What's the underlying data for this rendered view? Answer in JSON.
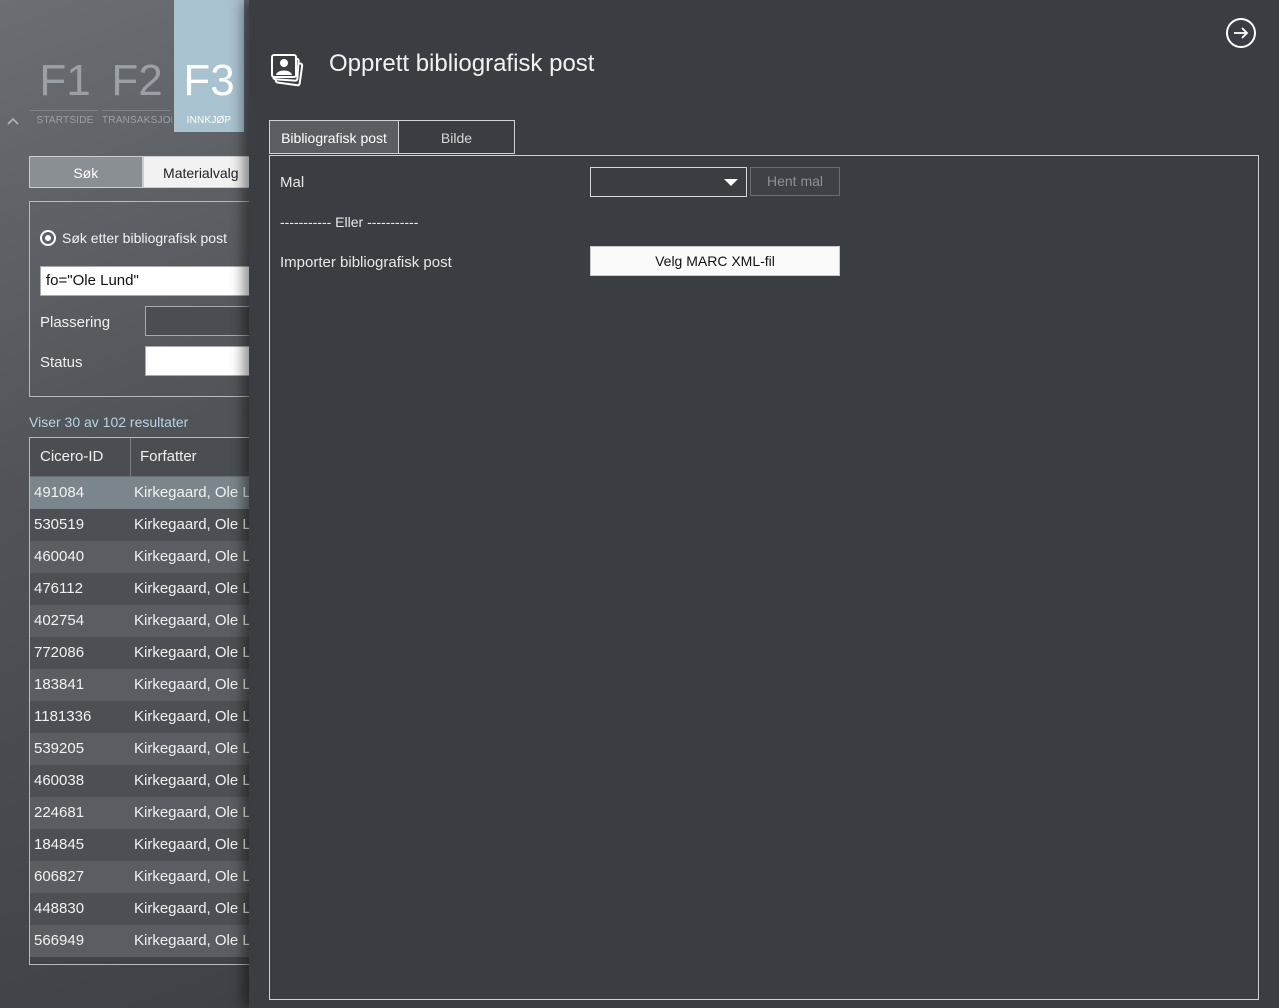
{
  "background": {
    "fkeys": [
      {
        "key": "F1",
        "label": "STARTSIDE",
        "active": false
      },
      {
        "key": "F2",
        "label": "TRANSAKSJONER",
        "active": false
      },
      {
        "key": "F3",
        "label": "INNKJØP",
        "active": true
      }
    ],
    "tabs": {
      "search": "Søk",
      "material": "Materialvalg"
    },
    "search": {
      "radio_label": "Søk etter bibliografisk post",
      "query_value": "fo=\"Ole Lund\"",
      "location_label": "Plassering",
      "status_label": "Status"
    },
    "result_count": "Viser 30 av 102 resultater",
    "grid": {
      "headers": [
        "Cicero-ID",
        "Forfatter"
      ],
      "rows": [
        {
          "id": "491084",
          "author": "Kirkegaard, Ole Lund"
        },
        {
          "id": "530519",
          "author": "Kirkegaard, Ole Lund"
        },
        {
          "id": "460040",
          "author": "Kirkegaard, Ole Lund"
        },
        {
          "id": "476112",
          "author": "Kirkegaard, Ole Lund"
        },
        {
          "id": "402754",
          "author": "Kirkegaard, Ole Lund"
        },
        {
          "id": "772086",
          "author": "Kirkegaard, Ole Lund"
        },
        {
          "id": "183841",
          "author": "Kirkegaard, Ole Lund"
        },
        {
          "id": "1181336",
          "author": "Kirkegaard, Ole Lund"
        },
        {
          "id": "539205",
          "author": "Kirkegaard, Ole Lund"
        },
        {
          "id": "460038",
          "author": "Kirkegaard, Ole Lund"
        },
        {
          "id": "224681",
          "author": "Kirkegaard, Ole Lund"
        },
        {
          "id": "184845",
          "author": "Kirkegaard, Ole Lund"
        },
        {
          "id": "606827",
          "author": "Kirkegaard, Ole Lund"
        },
        {
          "id": "448830",
          "author": "Kirkegaard, Ole Lund"
        },
        {
          "id": "566949",
          "author": "Kirkegaard, Ole Lund"
        }
      ]
    }
  },
  "panel": {
    "title": "Opprett bibliografisk post",
    "tabs": [
      "Bibliografisk post",
      "Bilde"
    ],
    "template_label": "Mal",
    "template_value": "",
    "fetch_template_button": "Hent mal",
    "or_divider": "----------- Eller -----------",
    "import_label": "Importer bibliografisk post",
    "choose_file_button": "Velg MARC XML-fil"
  },
  "colors": {
    "panel_bg": "#3a3e42",
    "active_fkey": "#a9c2cf",
    "result_count": "#b9d3e2"
  }
}
